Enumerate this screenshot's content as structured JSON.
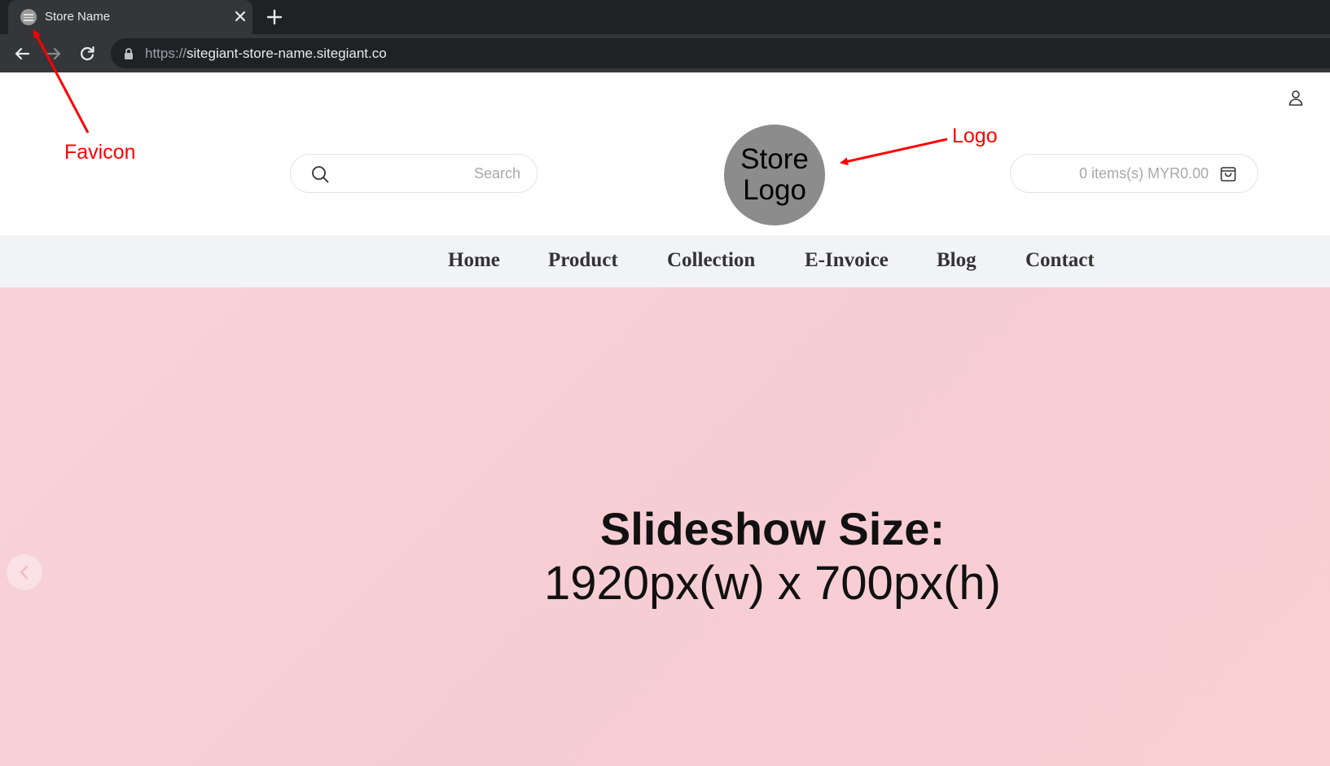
{
  "browser": {
    "tab_title": "Store Name",
    "url_scheme": "https://",
    "url_host": "sitegiant-store-name.sitegiant.co"
  },
  "header": {
    "search_placeholder": "Search",
    "logo_line1": "Store",
    "logo_line2": "Logo",
    "cart_text": "0 items(s) MYR0.00"
  },
  "nav": {
    "items": [
      "Home",
      "Product",
      "Collection",
      "E-Invoice",
      "Blog",
      "Contact"
    ]
  },
  "hero": {
    "title": "Slideshow Size:",
    "subtitle": "1920px(w) x 700px(h)"
  },
  "annotations": {
    "favicon_label": "Favicon",
    "logo_label": "Logo",
    "color": "#ff0000"
  }
}
